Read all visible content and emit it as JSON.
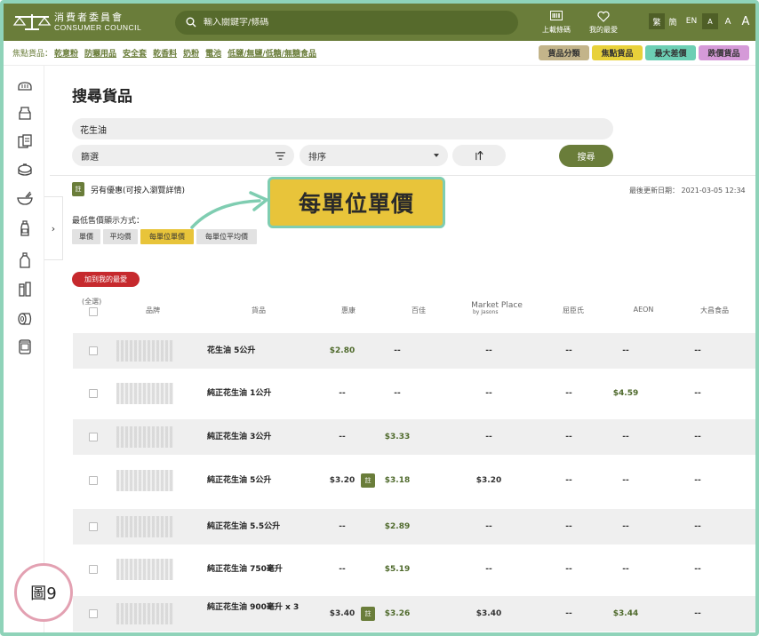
{
  "header": {
    "logo_cn": "消費者委員會",
    "logo_en": "CONSUMER COUNCIL",
    "search_placeholder": "輸入關鍵字/條碼",
    "scan_label": "上載條碼",
    "favourites_label": "我的最愛",
    "lang_tc": "繁",
    "lang_sc": "簡",
    "lang_en": "EN",
    "font_small": "A",
    "font_medium": "A",
    "font_large": "A"
  },
  "focus_bar": {
    "label": "焦點貨品：",
    "links": [
      "乾意粉",
      "防曬用品",
      "安全套",
      "乾香料",
      "奶粉",
      "電池",
      "低鹽/無鹽/低糖/無糖食品"
    ],
    "tags": [
      {
        "label": "貨品分類",
        "color": "#c3b48a"
      },
      {
        "label": "焦點貨品",
        "color": "#e8d13a"
      },
      {
        "label": "最大差價",
        "color": "#6ccfb4"
      },
      {
        "label": "跌價貨品",
        "color": "#d59ad8"
      }
    ]
  },
  "sidebar": {
    "icons": [
      "bread-icon",
      "milk-carton-icon",
      "cereal-box-icon",
      "rice-cooker-icon",
      "bowl-icon",
      "sauce-bottle-icon",
      "oil-bottle-icon",
      "toiletries-icon",
      "tissue-roll-icon",
      "canned-food-icon"
    ],
    "toggle": "›"
  },
  "main": {
    "title": "搜尋貨品",
    "keyword": "花生油",
    "filter_label": "篩選",
    "sort_label": "排序",
    "search_button": "搜尋",
    "offer_badge": "註",
    "offer_text": "另有優惠(可按入瀏覽詳情)",
    "updated": "最後更新日期： 2021-03-05 12:34",
    "callout": "每單位單價",
    "mode_label": "最低售價顯示方式：",
    "modes": [
      "單價",
      "平均價",
      "每單位單價",
      "每單位平均價"
    ],
    "active_mode": "每單位單價",
    "favourite_button": "加到我的最愛"
  },
  "table": {
    "select_all": "(全選)",
    "headers": {
      "brand": "品牌",
      "product": "貨品",
      "store1": "惠康",
      "store2": "百佳",
      "store3": "Market Place",
      "store3_sub": "by Jasons",
      "store4": "屈臣氏",
      "store5": "AEON",
      "store6": "大昌食品"
    },
    "rows": [
      {
        "product": "花生油 5公升",
        "prices": [
          "$2.80",
          "--",
          "--",
          "--",
          "--",
          "--"
        ],
        "badge": false
      },
      {
        "product": "純正花生油 1公升",
        "prices": [
          "--",
          "--",
          "--",
          "--",
          "$4.59",
          "--"
        ],
        "badge": false
      },
      {
        "product": "純正花生油 3公升",
        "prices": [
          "--",
          "$3.33",
          "--",
          "--",
          "--",
          "--"
        ],
        "badge": false
      },
      {
        "product": "純正花生油 5公升",
        "prices": [
          "$3.20",
          "$3.18",
          "$3.20",
          "--",
          "--",
          "--"
        ],
        "badge": true
      },
      {
        "product": "純正花生油 5.5公升",
        "prices": [
          "--",
          "$2.89",
          "--",
          "--",
          "--",
          "--"
        ],
        "badge": false
      },
      {
        "product": "純正花生油 750毫升",
        "prices": [
          "--",
          "$5.19",
          "--",
          "--",
          "--",
          "--"
        ],
        "badge": false
      },
      {
        "product": "純正花生油 900毫升 x 3",
        "prices": [
          "$3.40",
          "$3.26",
          "$3.40",
          "--",
          "$3.44",
          "--"
        ],
        "badge": true
      }
    ],
    "row_badge": "註"
  },
  "figure_label": "圖9"
}
